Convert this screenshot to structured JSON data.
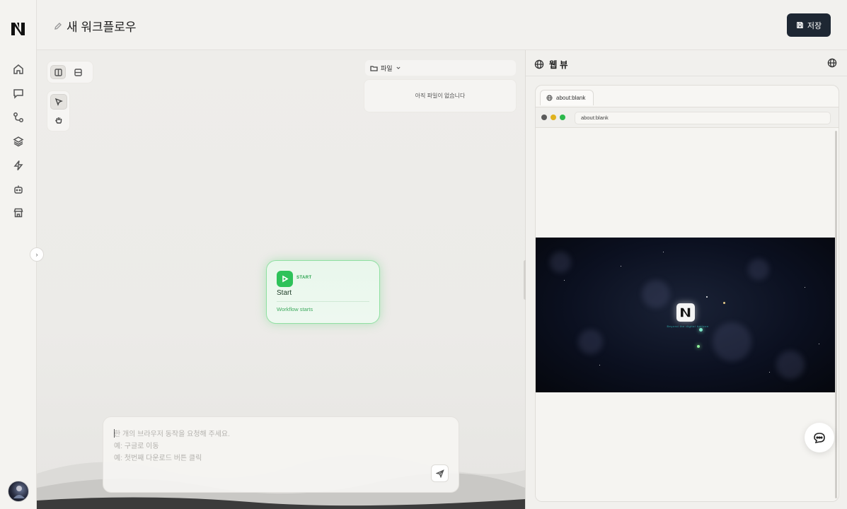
{
  "header": {
    "title": "새 워크플로우",
    "save_label": "저장"
  },
  "sidebar": {
    "items": [
      {
        "name": "home-icon"
      },
      {
        "name": "chat-icon"
      },
      {
        "name": "workflow-icon"
      },
      {
        "name": "layers-icon"
      },
      {
        "name": "lightning-icon"
      },
      {
        "name": "robot-icon"
      },
      {
        "name": "store-icon"
      }
    ]
  },
  "canvas": {
    "files_label": "파일",
    "files_empty": "아직 파일이 없습니다",
    "start_node": {
      "tag": "START",
      "title": "Start",
      "description": "Workflow starts"
    },
    "prompt": {
      "line1": "한 개의 브라우저 동작을 요청해 주세요.",
      "line2": "예: 구글로 이동",
      "line3": "예: 첫번째 다운로드 버튼 클릭"
    }
  },
  "webview": {
    "title": "웹 뷰",
    "tab_label": "about:blank",
    "url": "about:blank",
    "video_tagline": "Beyond the digital horizon"
  },
  "colors": {
    "accent_dark": "#1e2733",
    "start_green": "#2ec25a",
    "dot_red": "#5b5b5b",
    "dot_yellow": "#e0b21e",
    "dot_green": "#2cb84b"
  }
}
